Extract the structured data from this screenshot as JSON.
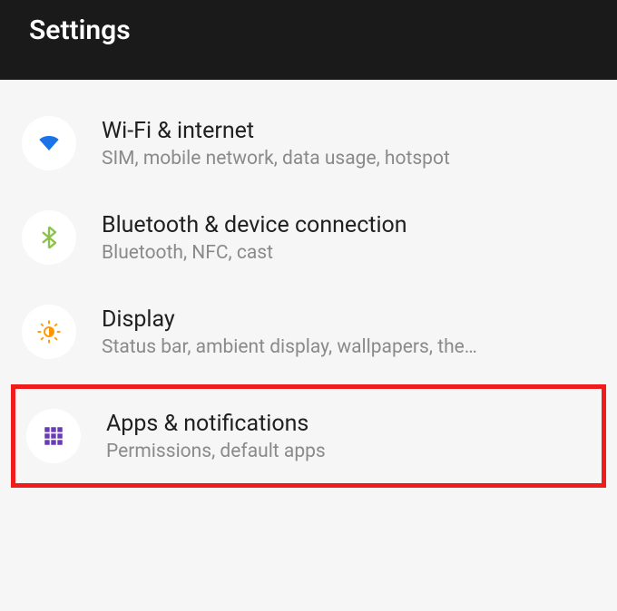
{
  "header": {
    "title": "Settings"
  },
  "items": [
    {
      "title": "Wi-Fi & internet",
      "subtitle": "SIM, mobile network, data usage, hotspot",
      "icon": "wifi-icon",
      "highlighted": false
    },
    {
      "title": "Bluetooth & device connection",
      "subtitle": "Bluetooth, NFC, cast",
      "icon": "bluetooth-icon",
      "highlighted": false
    },
    {
      "title": "Display",
      "subtitle": "Status bar, ambient display, wallpapers, the…",
      "icon": "display-icon",
      "highlighted": false
    },
    {
      "title": "Apps & notifications",
      "subtitle": "Permissions, default apps",
      "icon": "apps-icon",
      "highlighted": true
    }
  ],
  "colors": {
    "wifi": "#1a73e8",
    "bluetooth": "#8bc34a",
    "display": "#ff9800",
    "apps": "#673ab7"
  }
}
